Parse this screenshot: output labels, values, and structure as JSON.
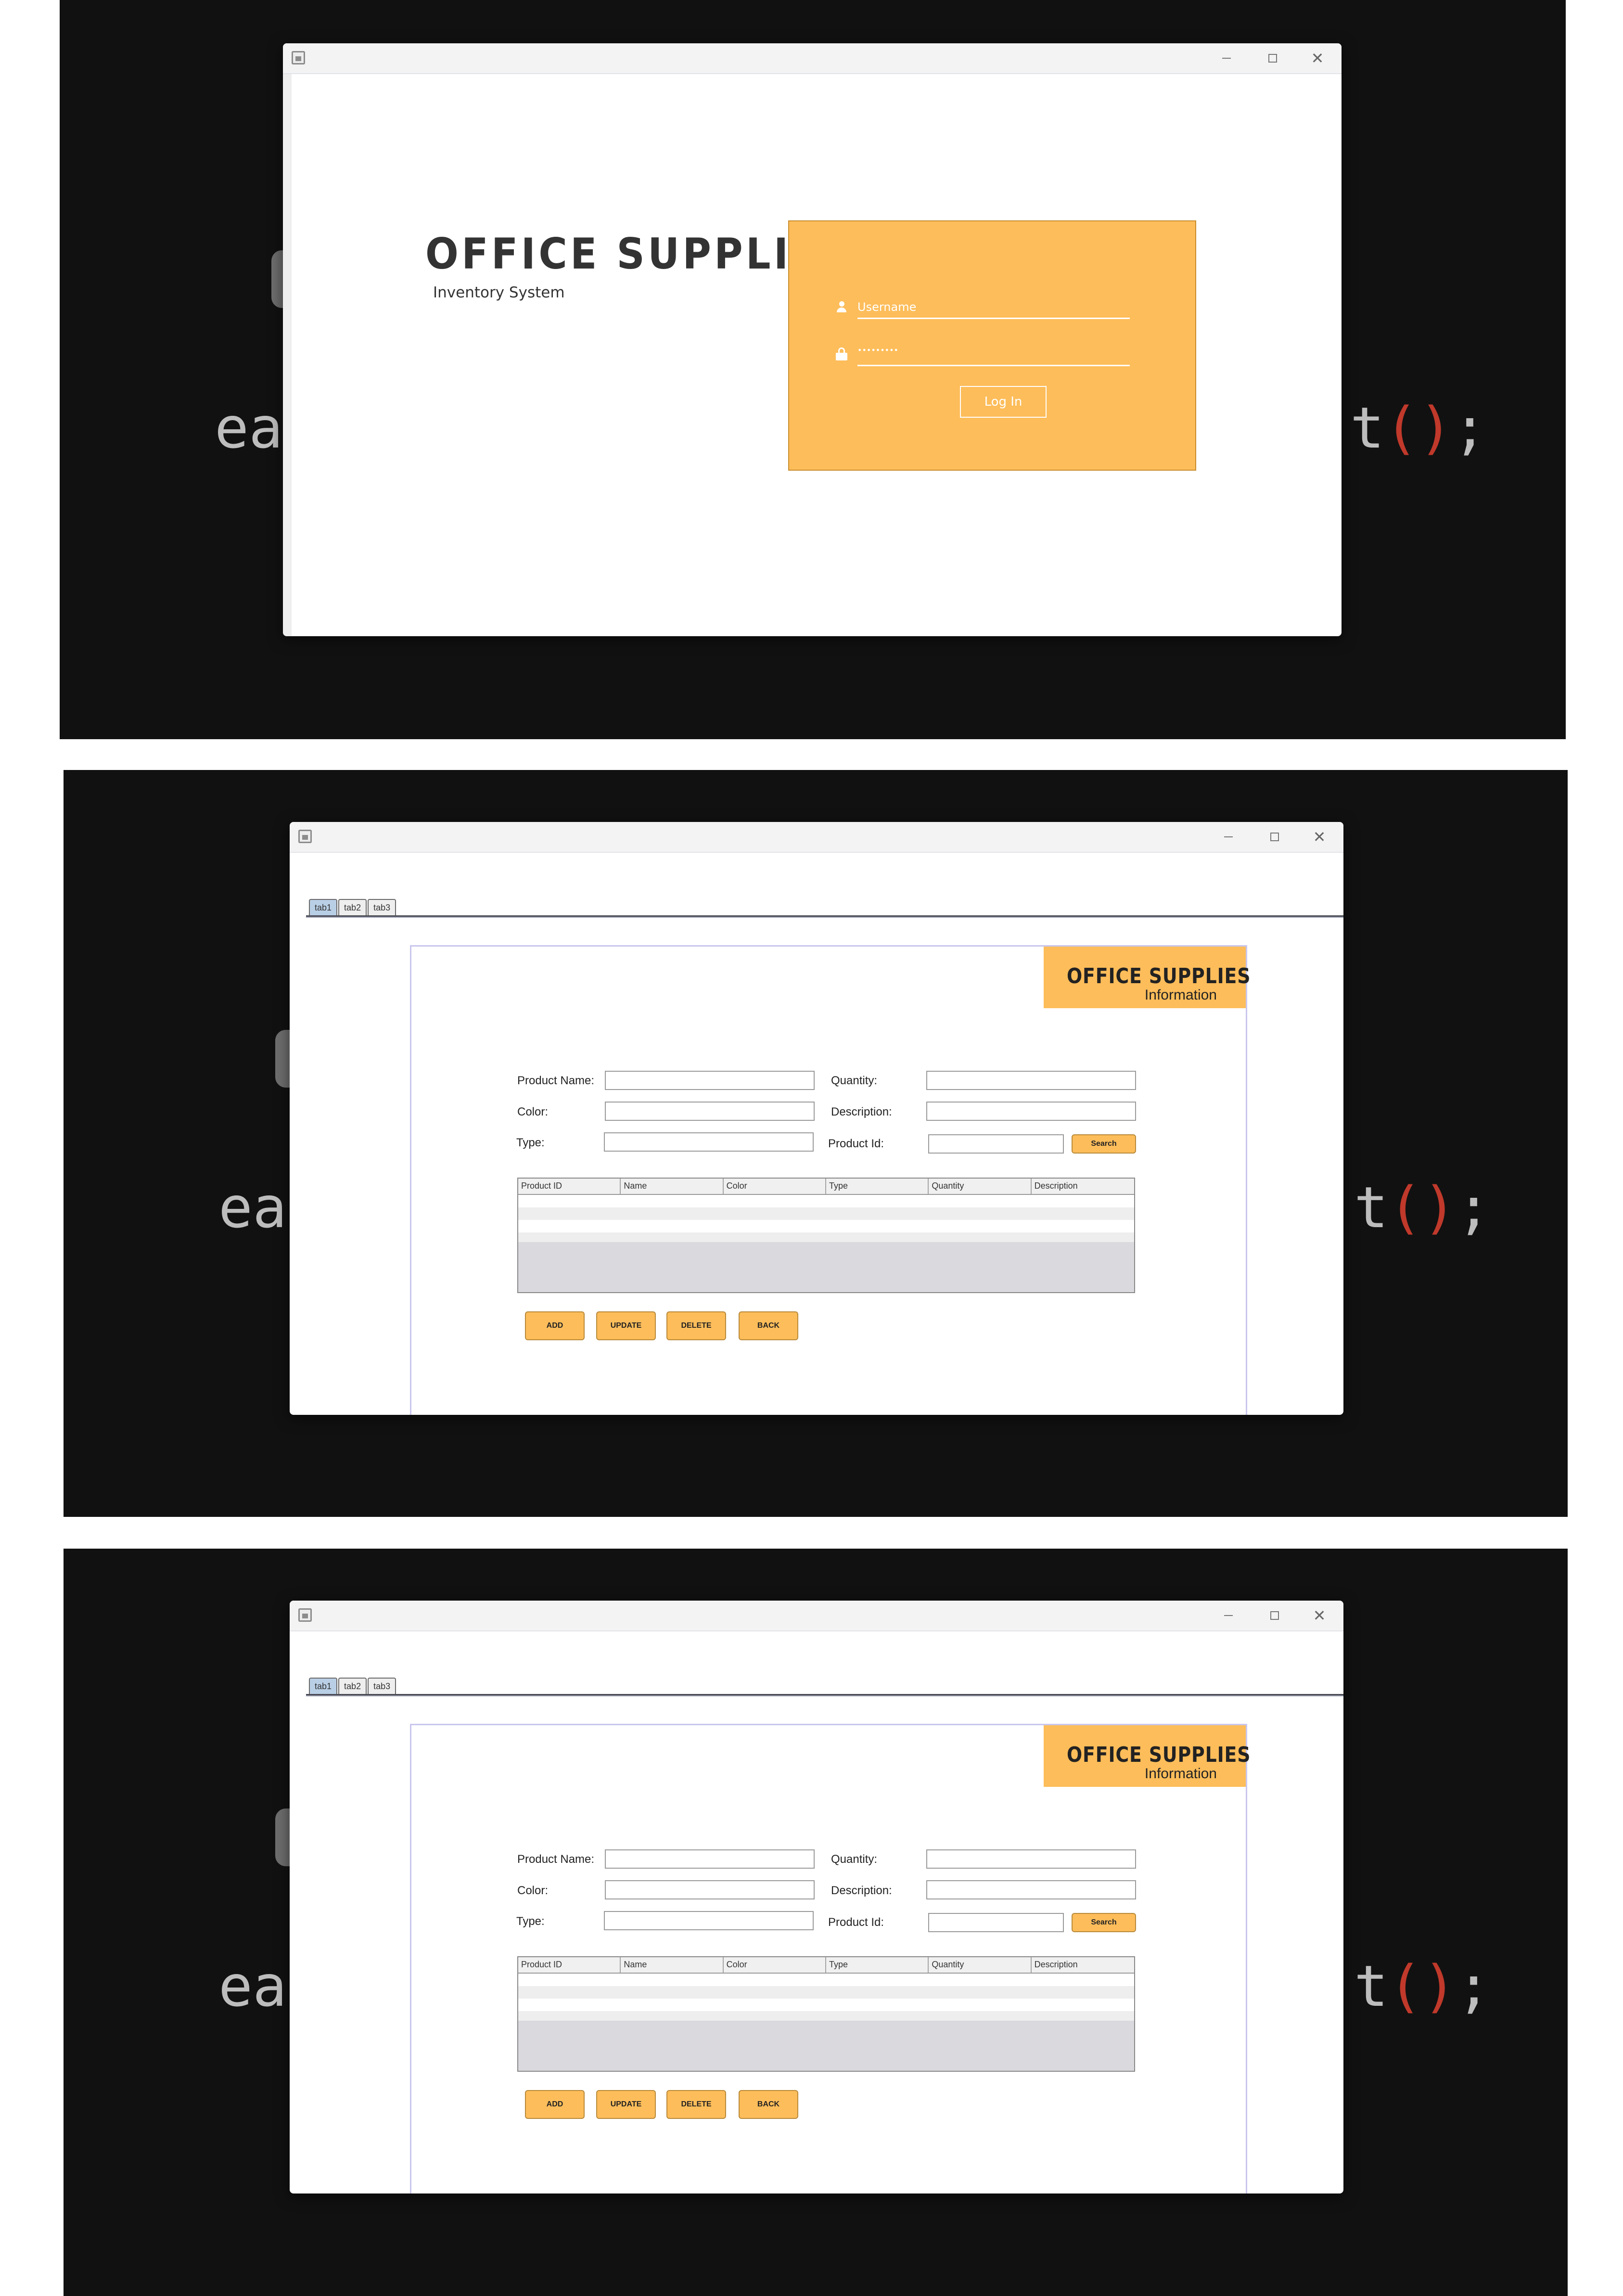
{
  "login_screen": {
    "brand_title": "OFFICE SUPPLIES",
    "brand_subtitle": "Inventory System",
    "username_placeholder": "Username",
    "password_value": "•••••••••",
    "login_button": "Log In"
  },
  "background_code": {
    "left_text": "ea",
    "right_text": "t",
    "parens": "()",
    "semicolon": ";"
  },
  "window_controls": {
    "minimize": "minimize",
    "maximize": "maximize",
    "close": "✕"
  },
  "tabs": [
    "tab1",
    "tab2",
    "tab3"
  ],
  "info_banner": {
    "title": "OFFICE SUPPLIES",
    "subtitle": "Information"
  },
  "form": {
    "product_name_label": "Product Name:",
    "quantity_label": "Quantity:",
    "color_label": "Color:",
    "description_label": "Description:",
    "type_label": "Type:",
    "product_id_label": "Product Id:",
    "search_button": "Search"
  },
  "table": {
    "columns": [
      "Product ID",
      "Name",
      "Color",
      "Type",
      "Quantity",
      "Description"
    ]
  },
  "actions": {
    "add": "ADD",
    "update": "UPDATE",
    "delete": "DELETE",
    "back": "BACK"
  },
  "colors": {
    "accent": "#fdbd5a",
    "background": "#111111",
    "tab_active": "#b9cfe6"
  }
}
